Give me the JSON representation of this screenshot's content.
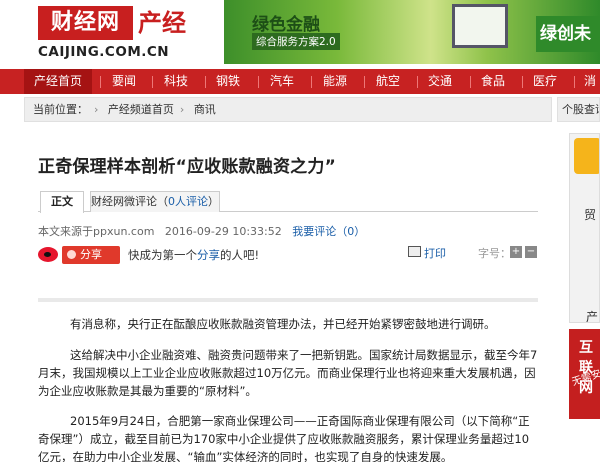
{
  "header": {
    "logo_box": "财经网",
    "logo_cn": "产经",
    "logo_url": "CAIJING.COM.CN",
    "banner_title": "绿色金融",
    "banner_sub": "综合服务方案2.0",
    "banner_right": "绿创未"
  },
  "nav": [
    {
      "label": "产经首页",
      "active": true
    },
    {
      "label": "要闻"
    },
    {
      "label": "科技"
    },
    {
      "label": "钢铁"
    },
    {
      "label": "汽车"
    },
    {
      "label": "能源"
    },
    {
      "label": "航空"
    },
    {
      "label": "交通"
    },
    {
      "label": "食品"
    },
    {
      "label": "医疗"
    },
    {
      "label": "消"
    }
  ],
  "breadcrumb": {
    "label": "当前位置：",
    "items": [
      "产经频道首页",
      "商讯"
    ]
  },
  "sidebar": {
    "head": "个股查询",
    "ad_text1": "贸",
    "ad_text2": "产",
    "ad2_text": "无需安",
    "ad2_text2": "互联网"
  },
  "article": {
    "title": "正奇保理样本剖析“应收账款融资之力”",
    "tab_main": "正文",
    "tab_comment_pre": "财经网微评论（",
    "tab_comment_count": "0人评论",
    "tab_comment_post": "）",
    "source": "本文来源于ppxun.com",
    "date": "2016-09-29 10:33:52",
    "comment_link": "我要评论（0）",
    "share_label": "分享",
    "share_pre": "快成为第一个",
    "share_link": "分享",
    "share_post": "的人吧!",
    "print": "打印",
    "font_size": "字号：",
    "paragraphs": [
      "有消息称，央行正在酝酿应收账款融资管理办法，并已经开始紧锣密鼓地进行调研。",
      "这给解决中小企业融资难、融资贵问题带来了一把新钥匙。国家统计局数据显示，截至今年7月末，我国规模以上工业企业应收账款超过10万亿元。而商业保理行业也将迎来重大发展机遇，因为企业应收账款是其最为重要的“原材料”。",
      "2015年9月24日，合肥第一家商业保理公司——正奇国际商业保理有限公司（以下简称“正奇保理”）成立，截至目前已为170家中小企业提供了应收账款融资服务，累计保理业务量超过10亿元，在助力中小企业发展、“输血”实体经济的同时，也实现了自身的快速发展。"
    ]
  }
}
